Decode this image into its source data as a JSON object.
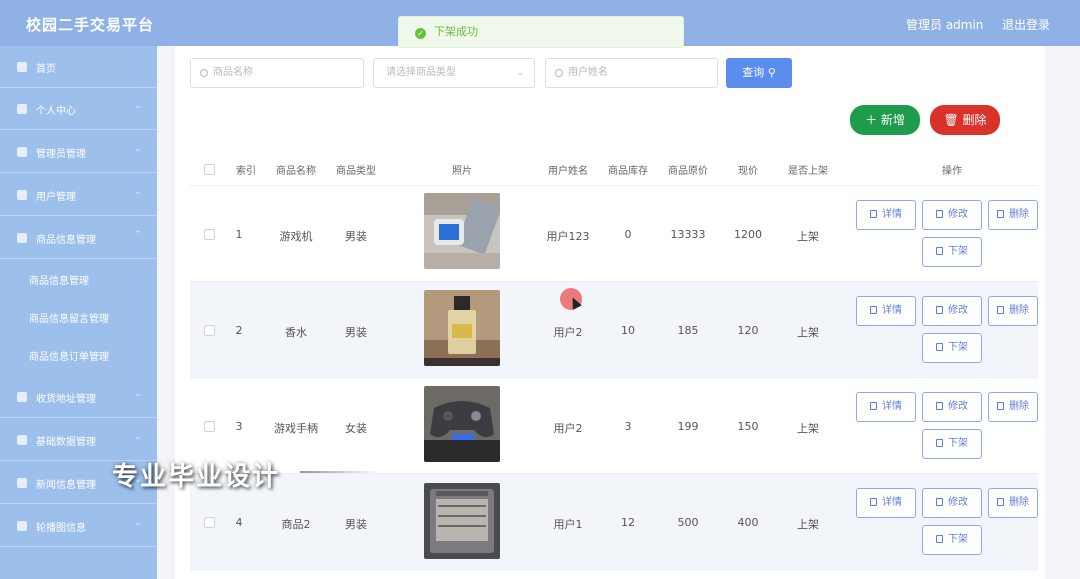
{
  "header": {
    "brand": "校园二手交易平台",
    "user": "管理员 admin",
    "logout": "退出登录"
  },
  "toast": {
    "message": "下架成功"
  },
  "sidebar": {
    "items": [
      {
        "label": "首页"
      },
      {
        "label": "个人中心"
      },
      {
        "label": "管理员管理"
      },
      {
        "label": "用户管理"
      },
      {
        "label": "商品信息管理"
      },
      {
        "label": "收货地址管理"
      },
      {
        "label": "基础数据管理"
      },
      {
        "label": "新闻信息管理"
      },
      {
        "label": "轮播图信息"
      }
    ],
    "subitems": [
      {
        "label": "商品信息管理"
      },
      {
        "label": "商品信息留言管理"
      },
      {
        "label": "商品信息订单管理"
      }
    ]
  },
  "search": {
    "name_placeholder": "商品名称",
    "type_placeholder": "请选择商品类型",
    "user_placeholder": "用户姓名",
    "button": "查询"
  },
  "actions": {
    "add": "新增",
    "delete": "删除"
  },
  "table": {
    "headers": [
      "索引",
      "商品名称",
      "商品类型",
      "照片",
      "用户姓名",
      "商品库存",
      "商品原价",
      "现价",
      "是否上架",
      "操作"
    ],
    "rows": [
      {
        "index": "1",
        "name": "游戏机",
        "type": "男装",
        "user": "用户123",
        "stock": "0",
        "original": "13333",
        "price": "1200",
        "status": "上架",
        "photo": "game-console-photo"
      },
      {
        "index": "2",
        "name": "香水",
        "type": "男装",
        "user": "用户2",
        "stock": "10",
        "original": "185",
        "price": "120",
        "status": "上架",
        "photo": "perfume-photo"
      },
      {
        "index": "3",
        "name": "游戏手柄",
        "type": "女装",
        "user": "用户2",
        "stock": "3",
        "original": "199",
        "price": "150",
        "status": "上架",
        "photo": "gamepad-photo"
      },
      {
        "index": "4",
        "name": "商品2",
        "type": "男装",
        "user": "用户1",
        "stock": "12",
        "original": "500",
        "price": "400",
        "status": "上架",
        "photo": "appliance-photo"
      }
    ],
    "ops": {
      "detail": "详情",
      "edit": "修改",
      "delete": "删除",
      "offline": "下架"
    }
  },
  "watermark": "专业毕业设计",
  "colors": {
    "topbar": "#8fb1e6",
    "sidebar": "#9dbfec",
    "add": "#1e9c4b",
    "delete": "#d8322a",
    "primary": "#5b8def"
  }
}
